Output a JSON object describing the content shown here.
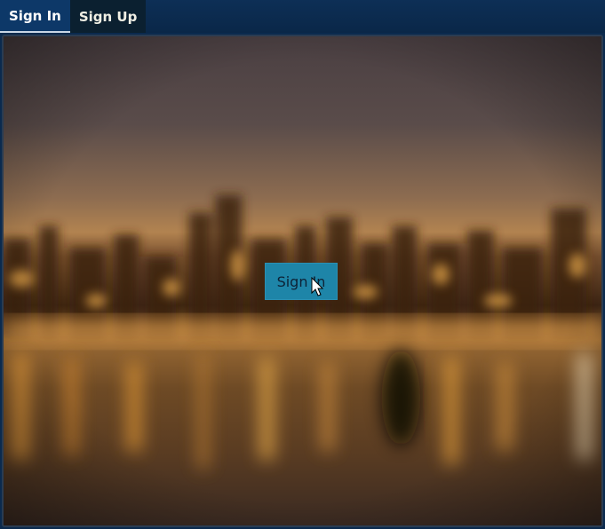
{
  "tabs": [
    {
      "label": "Sign In",
      "active": true
    },
    {
      "label": "Sign Up",
      "active": false
    }
  ],
  "main": {
    "sign_in_label": "Sign In"
  },
  "colors": {
    "tabbar": "#0d2f56",
    "active_tab": "#0d3868",
    "inactive_tab": "#0b2030",
    "button": "#1e85a8"
  },
  "icons": {
    "cursor": "mouse-pointer-icon"
  }
}
